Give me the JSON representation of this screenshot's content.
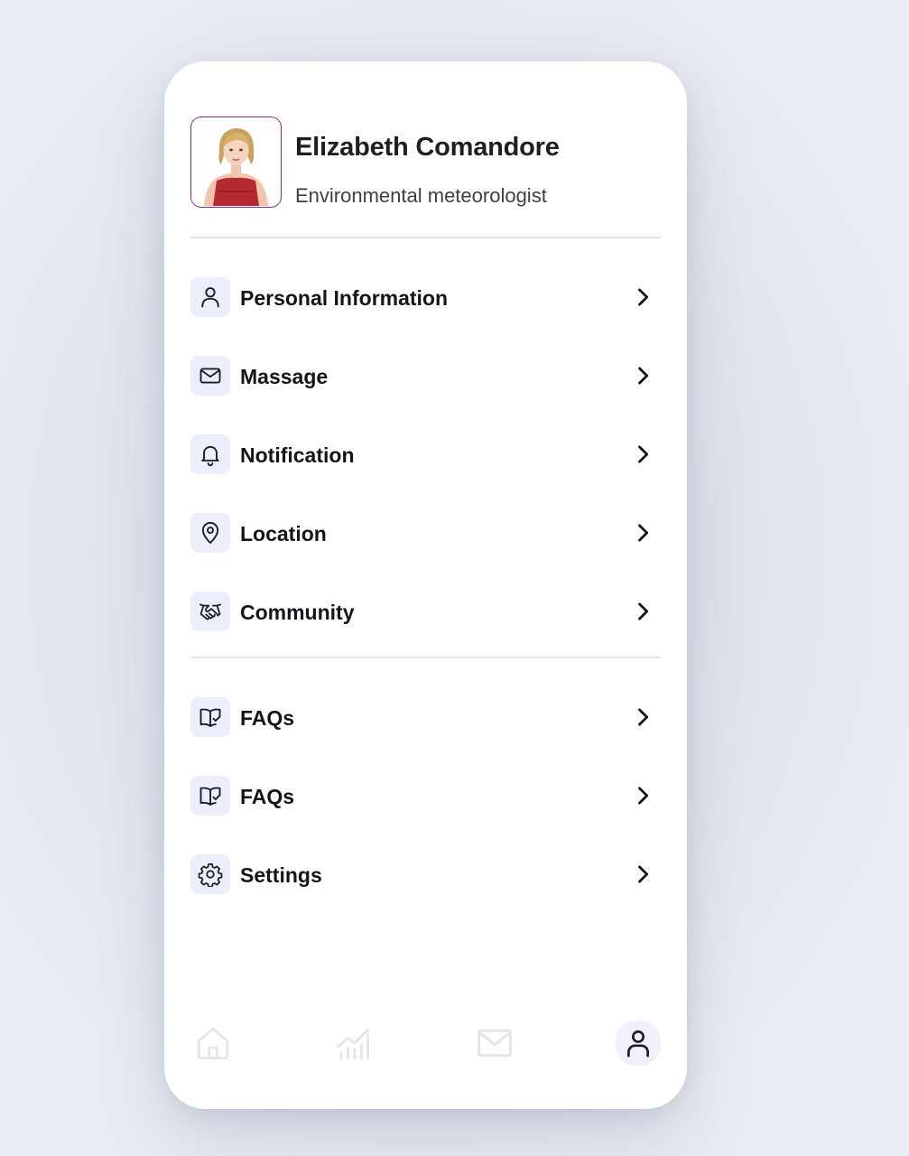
{
  "profile": {
    "name": "Elizabeth Comandore",
    "role": "Environmental meteorologist",
    "avatar_border_color": "#8b2a86"
  },
  "menu": {
    "primary": [
      {
        "label": "Personal Information",
        "icon": "user-icon"
      },
      {
        "label": "Massage",
        "icon": "mail-icon"
      },
      {
        "label": "Notification",
        "icon": "bell-icon"
      },
      {
        "label": "Location",
        "icon": "location-pin-icon"
      },
      {
        "label": "Community",
        "icon": "handshake-icon"
      }
    ],
    "secondary": [
      {
        "label": "FAQs",
        "icon": "book-check-icon"
      },
      {
        "label": "FAQs",
        "icon": "book-check-icon"
      },
      {
        "label": "Settings",
        "icon": "gear-icon"
      }
    ]
  },
  "bottom_nav": {
    "items": [
      {
        "icon": "home-icon",
        "active": false
      },
      {
        "icon": "chart-icon",
        "active": false
      },
      {
        "icon": "mail-icon",
        "active": false
      },
      {
        "icon": "user-icon",
        "active": true
      }
    ]
  },
  "colors": {
    "icon_box_bg": "#eceefb",
    "inactive_nav": "#e3e5ec",
    "active_nav": "#1e1f24"
  }
}
